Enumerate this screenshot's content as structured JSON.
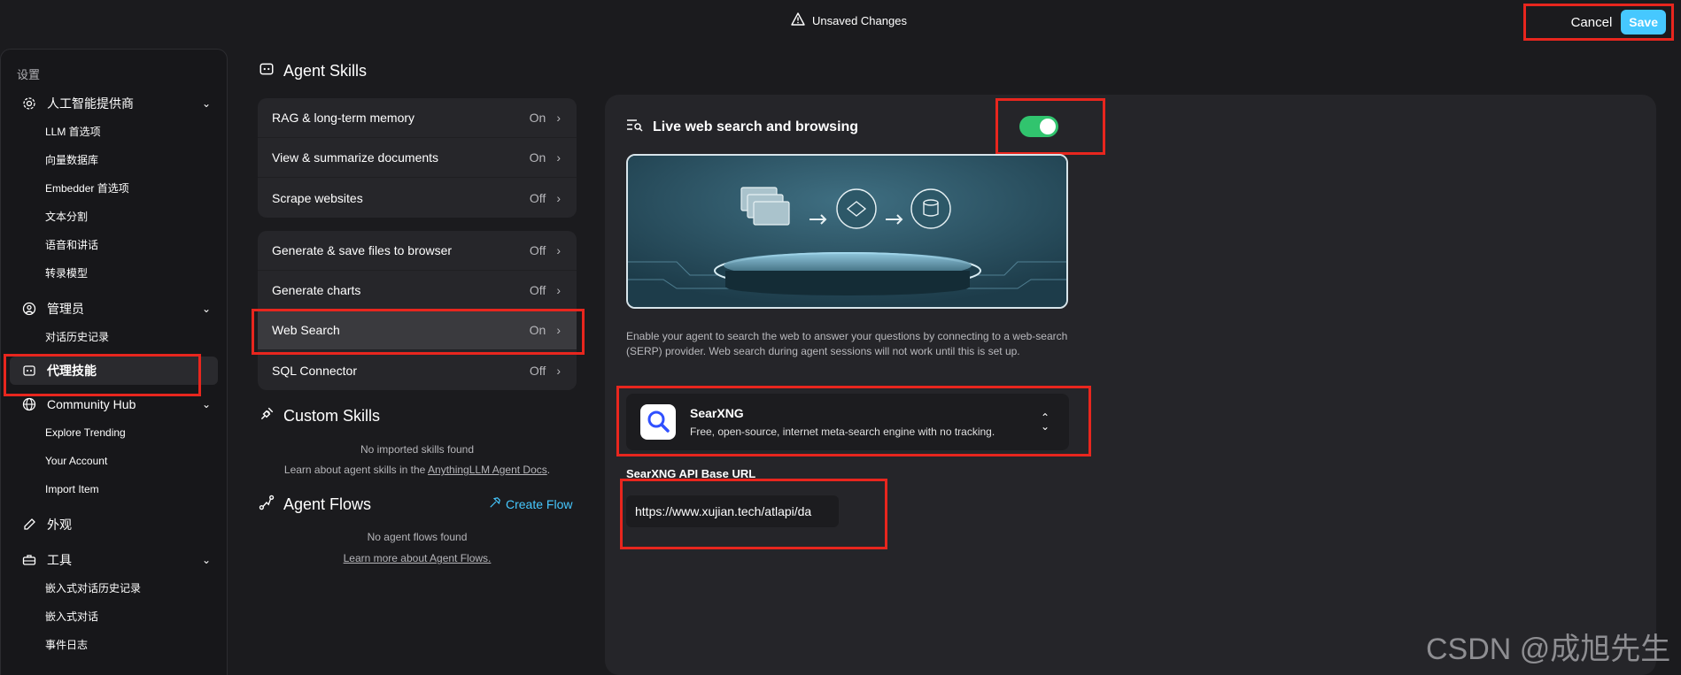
{
  "topbar": {
    "unsaved_label": "Unsaved Changes",
    "cancel_label": "Cancel",
    "save_label": "Save",
    "save_color": "#46c8ff"
  },
  "sidebar": {
    "caption": "设置",
    "groups": [
      {
        "label": "人工智能提供商",
        "icon": "gear-icon",
        "items": [
          "LLM 首选项",
          "向量数据库",
          "Embedder 首选项",
          "文本分割",
          "语音和讲话",
          "转录模型"
        ]
      },
      {
        "label": "管理员",
        "icon": "user-admin-icon",
        "items": [
          "对话历史记录"
        ]
      },
      {
        "label": "代理技能",
        "icon": "agent-icon",
        "items": []
      },
      {
        "label": "Community Hub",
        "icon": "globe-icon",
        "items": [
          "Explore Trending",
          "Your Account",
          "Import Item"
        ]
      },
      {
        "label": "外观",
        "icon": "brush-icon",
        "items": []
      },
      {
        "label": "工具",
        "icon": "toolbox-icon",
        "items": [
          "嵌入式对话历史记录",
          "嵌入式对话",
          "事件日志"
        ]
      }
    ]
  },
  "agent_skills": {
    "title": "Agent Skills",
    "group1": [
      {
        "label": "RAG & long-term memory",
        "status": "On"
      },
      {
        "label": "View & summarize documents",
        "status": "On"
      },
      {
        "label": "Scrape websites",
        "status": "Off"
      }
    ],
    "group2": [
      {
        "label": "Generate & save files to browser",
        "status": "Off"
      },
      {
        "label": "Generate charts",
        "status": "Off"
      },
      {
        "label": "Web Search",
        "status": "On"
      },
      {
        "label": "SQL Connector",
        "status": "Off"
      }
    ]
  },
  "custom_skills": {
    "title": "Custom Skills",
    "empty": "No imported skills found",
    "learn_prefix": "Learn about agent skills in the ",
    "learn_link": "AnythingLLM Agent Docs",
    "learn_suffix": "."
  },
  "agent_flows": {
    "title": "Agent Flows",
    "create_label": "Create Flow",
    "empty": "No agent flows found",
    "learn_link": "Learn more about Agent Flows."
  },
  "web_search": {
    "title": "Live web search and browsing",
    "enabled": true,
    "toggle_color": "#31c46e",
    "description": "Enable your agent to search the web to answer your questions by connecting to a web-search (SERP) provider. Web search during agent sessions will not work until this is set up.",
    "provider": {
      "name": "SearXNG",
      "description": "Free, open-source, internet meta-search engine with no tracking."
    },
    "field_label": "SearXNG API Base URL",
    "field_value": "https://www.xujian.tech/atlapi/da"
  },
  "watermark": "CSDN @成旭先生"
}
